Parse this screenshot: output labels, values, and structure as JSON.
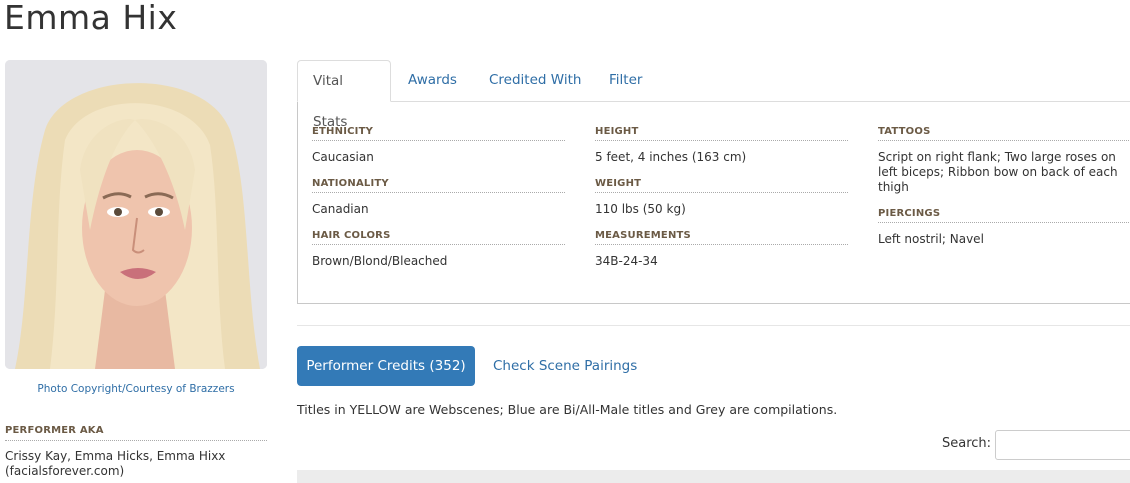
{
  "performer": {
    "name": "Emma Hix",
    "photo_credit": "Photo Copyright/Courtesy of Brazzers",
    "aka_heading": "PERFORMER AKA",
    "aka_value": "Crissy Kay, Emma Hicks, Emma Hixx (facialsforever.com)"
  },
  "tabs": [
    {
      "label": "Vital Stats",
      "active": true
    },
    {
      "label": "Awards",
      "active": false
    },
    {
      "label": "Credited With",
      "active": false
    },
    {
      "label": "Filter",
      "active": false
    }
  ],
  "vital_stats": {
    "col1": [
      {
        "label": "ETHNICITY",
        "value": "Caucasian"
      },
      {
        "label": "NATIONALITY",
        "value": "Canadian"
      },
      {
        "label": "HAIR COLORS",
        "value": "Brown/Blond/Bleached"
      }
    ],
    "col2": [
      {
        "label": "HEIGHT",
        "value": "5 feet, 4 inches (163 cm)"
      },
      {
        "label": "WEIGHT",
        "value": "110 lbs (50 kg)"
      },
      {
        "label": "MEASUREMENTS",
        "value": "34B-24-34"
      }
    ],
    "col3": [
      {
        "label": "TATTOOS",
        "value": "Script on right flank; Two large roses on left biceps; Ribbon bow on back of each thigh"
      },
      {
        "label": "PIERCINGS",
        "value": "Left nostril; Navel"
      }
    ]
  },
  "credits": {
    "button_label": "Performer Credits (352)",
    "pairings_label": "Check Scene Pairings",
    "legend_note": "Titles in YELLOW are Webscenes; Blue are Bi/All-Male titles and Grey are compilations.",
    "search_label": "Search:",
    "search_value": ""
  },
  "colors": {
    "accent": "#337ab7",
    "link": "#2f6ea6",
    "label": "#6b5a45"
  }
}
